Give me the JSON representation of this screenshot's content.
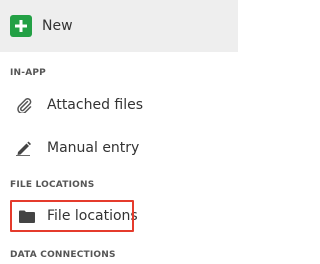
{
  "new_button": {
    "label": "New",
    "icon": "plus-icon",
    "color": "#23a045"
  },
  "sections": {
    "in_app": {
      "title": "IN-APP",
      "items": [
        {
          "label": "Attached files",
          "icon": "paperclip-icon"
        },
        {
          "label": "Manual entry",
          "icon": "pencil-icon"
        }
      ]
    },
    "file_locations": {
      "title": "FILE LOCATIONS",
      "items": [
        {
          "label": "File locations",
          "icon": "folder-icon",
          "highlighted": true
        }
      ]
    },
    "data_connections": {
      "title": "DATA CONNECTIONS"
    }
  },
  "colors": {
    "highlight_border": "#e53b2c",
    "new_row_background": "#eeeeee"
  }
}
